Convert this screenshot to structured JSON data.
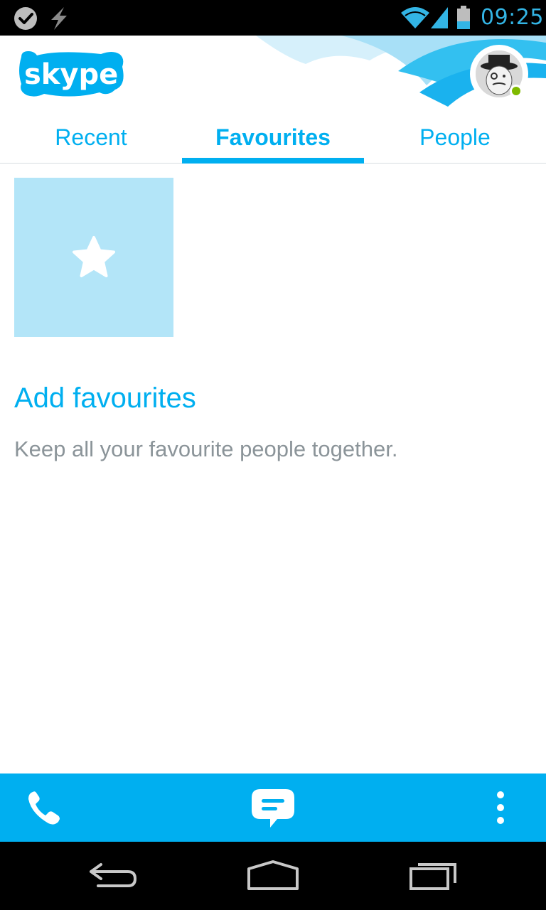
{
  "status_bar": {
    "time": "09:25",
    "icons": [
      "skype-notification-icon",
      "flash-icon",
      "wifi-icon",
      "signal-icon",
      "battery-icon"
    ]
  },
  "header": {
    "logo_text": "skype",
    "avatar_icon": "profile-avatar",
    "presence_status_color": "#7fba00"
  },
  "tabs": [
    {
      "label": "Recent",
      "selected": false
    },
    {
      "label": "Favourites",
      "selected": true
    },
    {
      "label": "People",
      "selected": false
    }
  ],
  "empty_state": {
    "icon": "star-icon",
    "title": "Add favourites",
    "description": "Keep all your favourite people together."
  },
  "action_bar": {
    "icons": [
      "phone-icon",
      "chat-icon",
      "overflow-menu-icon"
    ]
  },
  "nav_bar": {
    "icons": [
      "back-icon",
      "home-icon",
      "recent-apps-icon"
    ]
  },
  "colors": {
    "accent": "#00aff0",
    "tile": "#b3e5f8",
    "secondary_text": "#8b9499",
    "status_time": "#33b5e5"
  }
}
